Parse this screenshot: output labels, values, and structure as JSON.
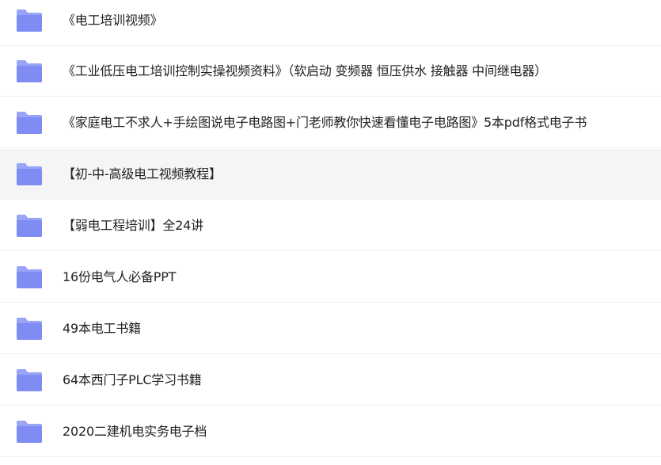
{
  "files": {
    "items": [
      {
        "name": "《电工培训视频》",
        "icon": "folder-icon"
      },
      {
        "name": "《工业低压电工培训控制实操视频资料》（软启动 变频器 恒压供水 接触器 中间继电器）",
        "icon": "folder-icon"
      },
      {
        "name": "《家庭电工不求人+手绘图说电子电路图+门老师教你快速看懂电子电路图》5本pdf格式电子书",
        "icon": "folder-icon"
      },
      {
        "name": "【初-中-高级电工视频教程】",
        "icon": "folder-icon",
        "hovered": true
      },
      {
        "name": "【弱电工程培训】全24讲",
        "icon": "folder-icon"
      },
      {
        "name": "16份电气人必备PPT",
        "icon": "folder-icon"
      },
      {
        "name": "49本电工书籍",
        "icon": "folder-icon"
      },
      {
        "name": "64本西门子PLC学习书籍",
        "icon": "folder-icon"
      },
      {
        "name": "2020二建机电实务电子档",
        "icon": "folder-icon"
      }
    ]
  },
  "colors": {
    "folder_back": "#9aa4f7",
    "folder_front": "#7e8cf3",
    "hover_bg": "#f5f5f6",
    "text": "#222222",
    "divider": "#f0f0f2"
  }
}
